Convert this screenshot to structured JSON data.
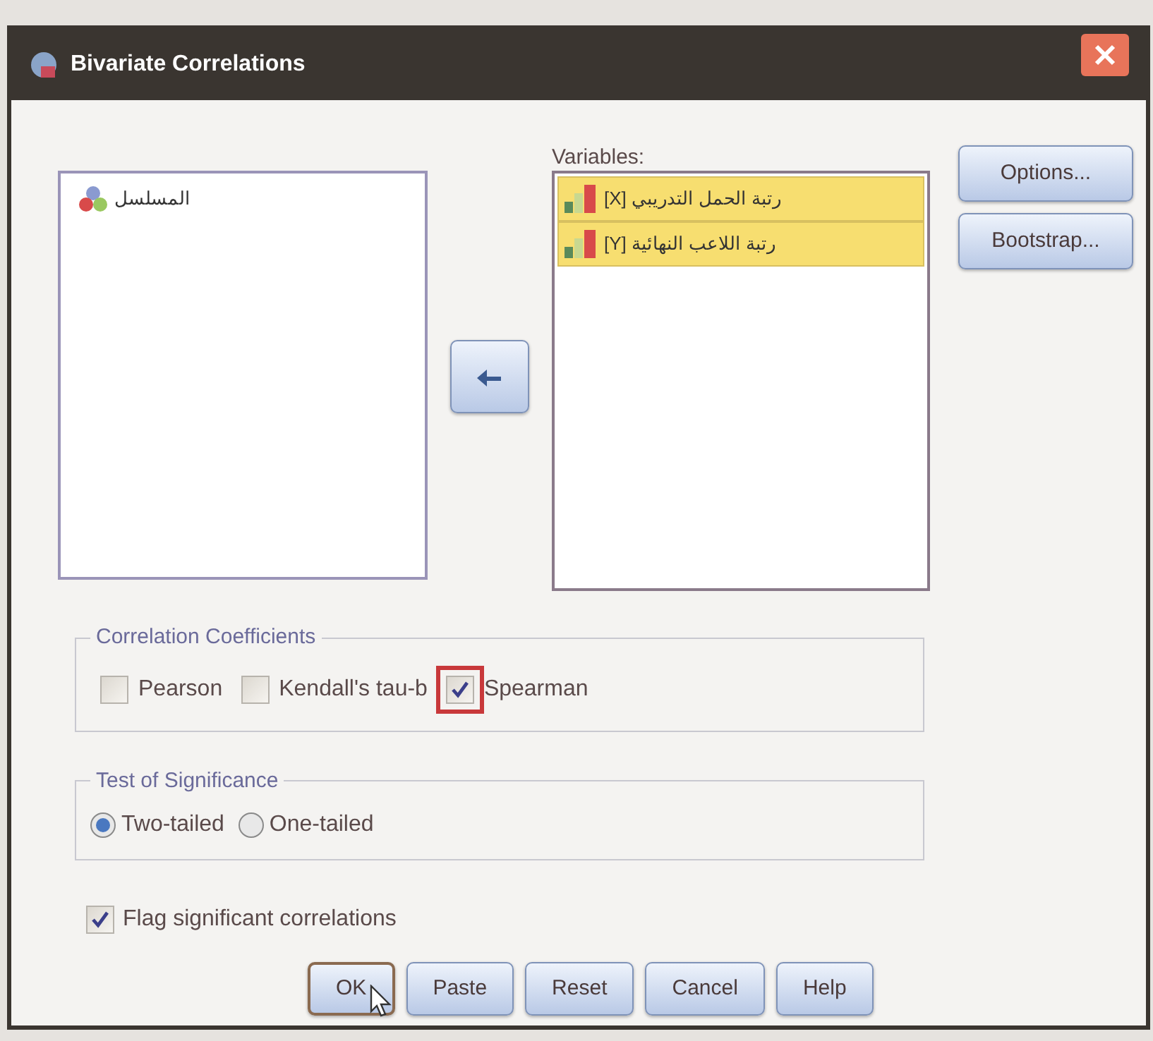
{
  "window": {
    "title": "Bivariate Correlations"
  },
  "source_list": {
    "items": [
      {
        "label": "المسلسل",
        "selected": false
      }
    ]
  },
  "variables": {
    "label": "Variables:",
    "items": [
      {
        "label": "رتبة الحمل التدريبي [X]",
        "selected": true
      },
      {
        "label": "رتبة اللاعب النهائية [Y]",
        "selected": true
      }
    ]
  },
  "side_buttons": [
    "Options...",
    "Bootstrap..."
  ],
  "correlation_coefficients": {
    "title": "Correlation Coefficients",
    "options": [
      {
        "label": "Pearson",
        "checked": false,
        "highlighted": false
      },
      {
        "label": "Kendall's tau-b",
        "checked": false,
        "highlighted": false
      },
      {
        "label": "Spearman",
        "checked": true,
        "highlighted": true
      }
    ]
  },
  "test_of_significance": {
    "title": "Test of Significance",
    "options": [
      {
        "label": "Two-tailed",
        "selected": true
      },
      {
        "label": "One-tailed",
        "selected": false
      }
    ]
  },
  "flag_significant": {
    "label": "Flag significant correlations",
    "checked": true
  },
  "buttons": [
    {
      "label": "OK",
      "focused": true
    },
    {
      "label": "Paste",
      "focused": false
    },
    {
      "label": "Reset",
      "focused": false
    },
    {
      "label": "Cancel",
      "focused": false
    },
    {
      "label": "Help",
      "focused": false
    }
  ]
}
